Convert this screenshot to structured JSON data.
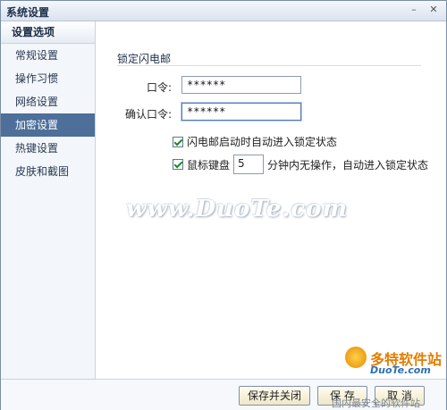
{
  "window": {
    "title": "系统设置",
    "minimize_glyph": "–",
    "close_glyph": "✕"
  },
  "sidebar": {
    "header": "设置选项",
    "items": [
      {
        "label": "常规设置"
      },
      {
        "label": "操作习惯"
      },
      {
        "label": "网络设置"
      },
      {
        "label": "加密设置"
      },
      {
        "label": "热键设置"
      },
      {
        "label": "皮肤和截图"
      }
    ],
    "active_index": 3
  },
  "lock": {
    "section_title": "锁定闪电邮",
    "password_label": "口令:",
    "password_value": "******",
    "confirm_label": "确认口令:",
    "confirm_value": "******",
    "auto_lock_on_start": {
      "checked": true,
      "label": "闪电邮启动时自动进入锁定状态"
    },
    "idle_lock": {
      "checked": true,
      "prefix": "鼠标键盘",
      "minutes": "5",
      "suffix": "分钟内无操作，自动进入锁定状态"
    }
  },
  "watermark": {
    "text": "www.DuoTe.com",
    "logo_cn": "多特软件站",
    "logo_en": "DuoTe.com",
    "logo_tag": "国内最安全的软件站"
  },
  "footer": {
    "save_close": "保存并关闭",
    "save": "保 存",
    "cancel": "取 消"
  },
  "colors": {
    "active_sidebar": "#4d6f9a",
    "check": "#1f8a1f"
  }
}
